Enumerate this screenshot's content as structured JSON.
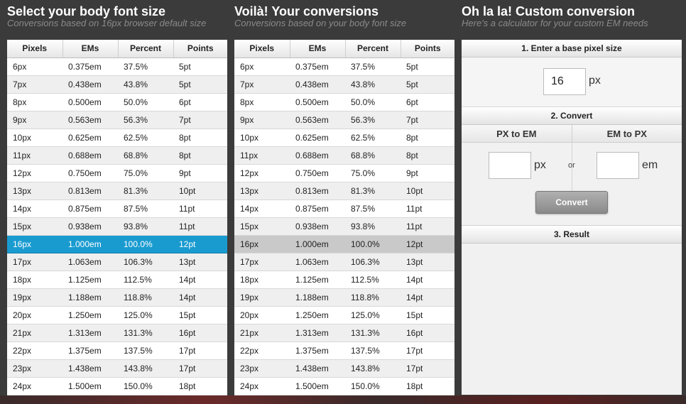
{
  "left": {
    "title": "Select your body font size",
    "subtitle": "Conversions based on 16px browser default size",
    "headers": [
      "Pixels",
      "EMs",
      "Percent",
      "Points"
    ],
    "selected_index": 10,
    "rows": [
      [
        "6px",
        "0.375em",
        "37.5%",
        "5pt"
      ],
      [
        "7px",
        "0.438em",
        "43.8%",
        "5pt"
      ],
      [
        "8px",
        "0.500em",
        "50.0%",
        "6pt"
      ],
      [
        "9px",
        "0.563em",
        "56.3%",
        "7pt"
      ],
      [
        "10px",
        "0.625em",
        "62.5%",
        "8pt"
      ],
      [
        "11px",
        "0.688em",
        "68.8%",
        "8pt"
      ],
      [
        "12px",
        "0.750em",
        "75.0%",
        "9pt"
      ],
      [
        "13px",
        "0.813em",
        "81.3%",
        "10pt"
      ],
      [
        "14px",
        "0.875em",
        "87.5%",
        "11pt"
      ],
      [
        "15px",
        "0.938em",
        "93.8%",
        "11pt"
      ],
      [
        "16px",
        "1.000em",
        "100.0%",
        "12pt"
      ],
      [
        "17px",
        "1.063em",
        "106.3%",
        "13pt"
      ],
      [
        "18px",
        "1.125em",
        "112.5%",
        "14pt"
      ],
      [
        "19px",
        "1.188em",
        "118.8%",
        "14pt"
      ],
      [
        "20px",
        "1.250em",
        "125.0%",
        "15pt"
      ],
      [
        "21px",
        "1.313em",
        "131.3%",
        "16pt"
      ],
      [
        "22px",
        "1.375em",
        "137.5%",
        "17pt"
      ],
      [
        "23px",
        "1.438em",
        "143.8%",
        "17pt"
      ],
      [
        "24px",
        "1.500em",
        "150.0%",
        "18pt"
      ]
    ]
  },
  "middle": {
    "title": "Voilà! Your conversions",
    "subtitle": "Conversions based on your body font size",
    "headers": [
      "Pixels",
      "EMs",
      "Percent",
      "Points"
    ],
    "selected_index": 10,
    "rows": [
      [
        "6px",
        "0.375em",
        "37.5%",
        "5pt"
      ],
      [
        "7px",
        "0.438em",
        "43.8%",
        "5pt"
      ],
      [
        "8px",
        "0.500em",
        "50.0%",
        "6pt"
      ],
      [
        "9px",
        "0.563em",
        "56.3%",
        "7pt"
      ],
      [
        "10px",
        "0.625em",
        "62.5%",
        "8pt"
      ],
      [
        "11px",
        "0.688em",
        "68.8%",
        "8pt"
      ],
      [
        "12px",
        "0.750em",
        "75.0%",
        "9pt"
      ],
      [
        "13px",
        "0.813em",
        "81.3%",
        "10pt"
      ],
      [
        "14px",
        "0.875em",
        "87.5%",
        "11pt"
      ],
      [
        "15px",
        "0.938em",
        "93.8%",
        "11pt"
      ],
      [
        "16px",
        "1.000em",
        "100.0%",
        "12pt"
      ],
      [
        "17px",
        "1.063em",
        "106.3%",
        "13pt"
      ],
      [
        "18px",
        "1.125em",
        "112.5%",
        "14pt"
      ],
      [
        "19px",
        "1.188em",
        "118.8%",
        "14pt"
      ],
      [
        "20px",
        "1.250em",
        "125.0%",
        "15pt"
      ],
      [
        "21px",
        "1.313em",
        "131.3%",
        "16pt"
      ],
      [
        "22px",
        "1.375em",
        "137.5%",
        "17pt"
      ],
      [
        "23px",
        "1.438em",
        "143.8%",
        "17pt"
      ],
      [
        "24px",
        "1.500em",
        "150.0%",
        "18pt"
      ]
    ]
  },
  "custom": {
    "title": "Oh la la! Custom conversion",
    "subtitle": "Here's a calculator for your custom EM needs",
    "step1_label": "1. Enter a base pixel size",
    "base_value": "16",
    "base_unit": "px",
    "step2_label": "2. Convert",
    "px_to_em_label": "PX to EM",
    "em_to_px_label": "EM to PX",
    "px_unit": "px",
    "em_unit": "em",
    "or_label": "or",
    "px_input_value": "",
    "em_input_value": "",
    "convert_button": "Convert",
    "step3_label": "3. Result"
  },
  "colors": {
    "background": "#3b3b3b",
    "selected_row": "#1a9bd0",
    "selected_row_mid": "#c9c9c9"
  }
}
